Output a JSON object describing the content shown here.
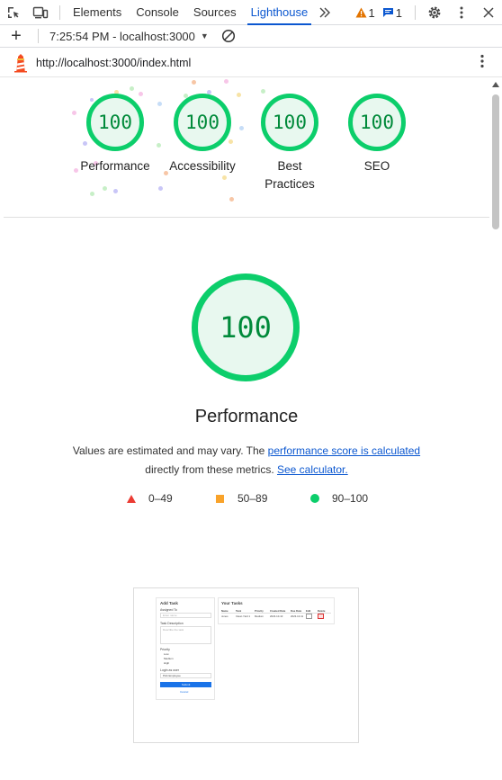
{
  "devtools": {
    "tabs": [
      "Elements",
      "Console",
      "Sources",
      "Lighthouse"
    ],
    "active_tab": "Lighthouse",
    "warnings_count": "1",
    "messages_count": "1"
  },
  "toolbar": {
    "report_time": "7:25:54 PM - localhost:3000"
  },
  "report": {
    "url": "http://localhost:3000/index.html",
    "categories": [
      {
        "label": "Performance",
        "score": "100"
      },
      {
        "label": "Accessibility",
        "score": "100"
      },
      {
        "label": "Best Practices",
        "score": "100"
      },
      {
        "label": "SEO",
        "score": "100"
      }
    ],
    "main_score": "100",
    "main_title": "Performance",
    "desc_pre": "Values are estimated and may vary. The ",
    "desc_link1": "performance score is calculated",
    "desc_mid": " directly from these metrics. ",
    "desc_link2": "See calculator.",
    "legend": [
      {
        "range": "0–49",
        "color": "#eb3b33"
      },
      {
        "range": "50–89",
        "color": "#f9a32a"
      },
      {
        "range": "90–100",
        "color": "#0cce6b"
      }
    ]
  },
  "screenshot": {
    "form_title": "Add Task",
    "assigned_label": "Assigned To",
    "assigned_placeholder": "Enter name",
    "desc_label": "Task Description",
    "desc_placeholder": "Describe the task",
    "priority_label": "Priority",
    "priority_options": [
      "Low",
      "Medium",
      "High"
    ],
    "user_label": "Login as user",
    "user_value": "Pick Employee",
    "submit": "Submit",
    "cancel": "Cancel",
    "list_title": "Your Tasks",
    "columns": [
      "Name",
      "Task",
      "Priority",
      "Created Date",
      "Due Date",
      "Edit",
      "Delete"
    ],
    "row": [
      "Jones",
      "Clean Yard 1",
      "Medium",
      "2023-10-10",
      "2023-10-11"
    ]
  }
}
